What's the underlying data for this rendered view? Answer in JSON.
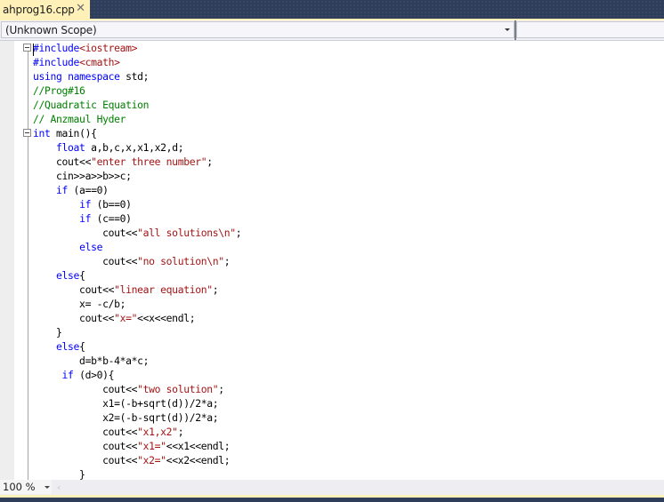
{
  "tab": {
    "title": "ahprog16.cpp",
    "close_icon": "close-icon"
  },
  "navbar": {
    "scope": "(Unknown Scope)",
    "member": ""
  },
  "statusbar": {
    "zoom": "100 %"
  },
  "colors": {
    "keyword": "#0000ff",
    "preprocessor": "#1515a3",
    "string": "#a31515",
    "comment": "#008000",
    "tab_active": "#fff1b8",
    "chrome_dark": "#2e3d5a"
  },
  "code": [
    [
      {
        "t": "#include",
        "c": "kw"
      },
      {
        "t": "<iostream>",
        "c": "str"
      }
    ],
    [
      {
        "t": "#include",
        "c": "kw"
      },
      {
        "t": "<cmath>",
        "c": "str"
      }
    ],
    [
      {
        "t": "using",
        "c": "kw"
      },
      {
        "t": " ",
        "c": "id"
      },
      {
        "t": "namespace",
        "c": "kw"
      },
      {
        "t": " std;",
        "c": "id"
      }
    ],
    [
      {
        "t": "//Prog#16",
        "c": "cm"
      }
    ],
    [
      {
        "t": "//Quadratic Equation",
        "c": "cm"
      }
    ],
    [
      {
        "t": "// Anzmaul Hyder",
        "c": "cm"
      }
    ],
    [
      {
        "t": "int",
        "c": "kw"
      },
      {
        "t": " main(){",
        "c": "id"
      }
    ],
    [
      {
        "t": "    ",
        "c": "id"
      },
      {
        "t": "float",
        "c": "kw"
      },
      {
        "t": " a,b,c,x,x1,x2,d;",
        "c": "id"
      }
    ],
    [
      {
        "t": "    cout<<",
        "c": "id"
      },
      {
        "t": "\"enter three number\"",
        "c": "str"
      },
      {
        "t": ";",
        "c": "id"
      }
    ],
    [
      {
        "t": "    cin>>a>>b>>c;",
        "c": "id"
      }
    ],
    [
      {
        "t": "    ",
        "c": "id"
      },
      {
        "t": "if",
        "c": "kw"
      },
      {
        "t": " (a==0)",
        "c": "id"
      }
    ],
    [
      {
        "t": "        ",
        "c": "id"
      },
      {
        "t": "if",
        "c": "kw"
      },
      {
        "t": " (b==0)",
        "c": "id"
      }
    ],
    [
      {
        "t": "        ",
        "c": "id"
      },
      {
        "t": "if",
        "c": "kw"
      },
      {
        "t": " (c==0)",
        "c": "id"
      }
    ],
    [
      {
        "t": "            cout<<",
        "c": "id"
      },
      {
        "t": "\"all solutions\\n\"",
        "c": "str"
      },
      {
        "t": ";",
        "c": "id"
      }
    ],
    [
      {
        "t": "        ",
        "c": "id"
      },
      {
        "t": "else",
        "c": "kw"
      }
    ],
    [
      {
        "t": "            cout<<",
        "c": "id"
      },
      {
        "t": "\"no solution\\n\"",
        "c": "str"
      },
      {
        "t": ";",
        "c": "id"
      }
    ],
    [
      {
        "t": "    ",
        "c": "id"
      },
      {
        "t": "else",
        "c": "kw"
      },
      {
        "t": "{",
        "c": "id"
      }
    ],
    [
      {
        "t": "        cout<<",
        "c": "id"
      },
      {
        "t": "\"linear equation\"",
        "c": "str"
      },
      {
        "t": ";",
        "c": "id"
      }
    ],
    [
      {
        "t": "        x= -c/b;",
        "c": "id"
      }
    ],
    [
      {
        "t": "        cout<<",
        "c": "id"
      },
      {
        "t": "\"x=\"",
        "c": "str"
      },
      {
        "t": "<<x<<endl;",
        "c": "id"
      }
    ],
    [
      {
        "t": "    }",
        "c": "id"
      }
    ],
    [
      {
        "t": "    ",
        "c": "id"
      },
      {
        "t": "else",
        "c": "kw"
      },
      {
        "t": "{",
        "c": "id"
      }
    ],
    [
      {
        "t": "        d=b*b-4*a*c;",
        "c": "id"
      }
    ],
    [
      {
        "t": "     ",
        "c": "id"
      },
      {
        "t": "if",
        "c": "kw"
      },
      {
        "t": " (d>0){",
        "c": "id"
      }
    ],
    [
      {
        "t": "            cout<<",
        "c": "id"
      },
      {
        "t": "\"two solution\"",
        "c": "str"
      },
      {
        "t": ";",
        "c": "id"
      }
    ],
    [
      {
        "t": "            x1=(-b+sqrt(d))/2*a;",
        "c": "id"
      }
    ],
    [
      {
        "t": "            x2=(-b-sqrt(d))/2*a;",
        "c": "id"
      }
    ],
    [
      {
        "t": "            cout<<",
        "c": "id"
      },
      {
        "t": "\"x1,x2\"",
        "c": "str"
      },
      {
        "t": ";",
        "c": "id"
      }
    ],
    [
      {
        "t": "            cout<<",
        "c": "id"
      },
      {
        "t": "\"x1=\"",
        "c": "str"
      },
      {
        "t": "<<x1<<endl;",
        "c": "id"
      }
    ],
    [
      {
        "t": "            cout<<",
        "c": "id"
      },
      {
        "t": "\"x2=\"",
        "c": "str"
      },
      {
        "t": "<<x2<<endl;",
        "c": "id"
      }
    ],
    [
      {
        "t": "        }",
        "c": "id"
      }
    ]
  ],
  "folds": [
    0,
    6
  ]
}
